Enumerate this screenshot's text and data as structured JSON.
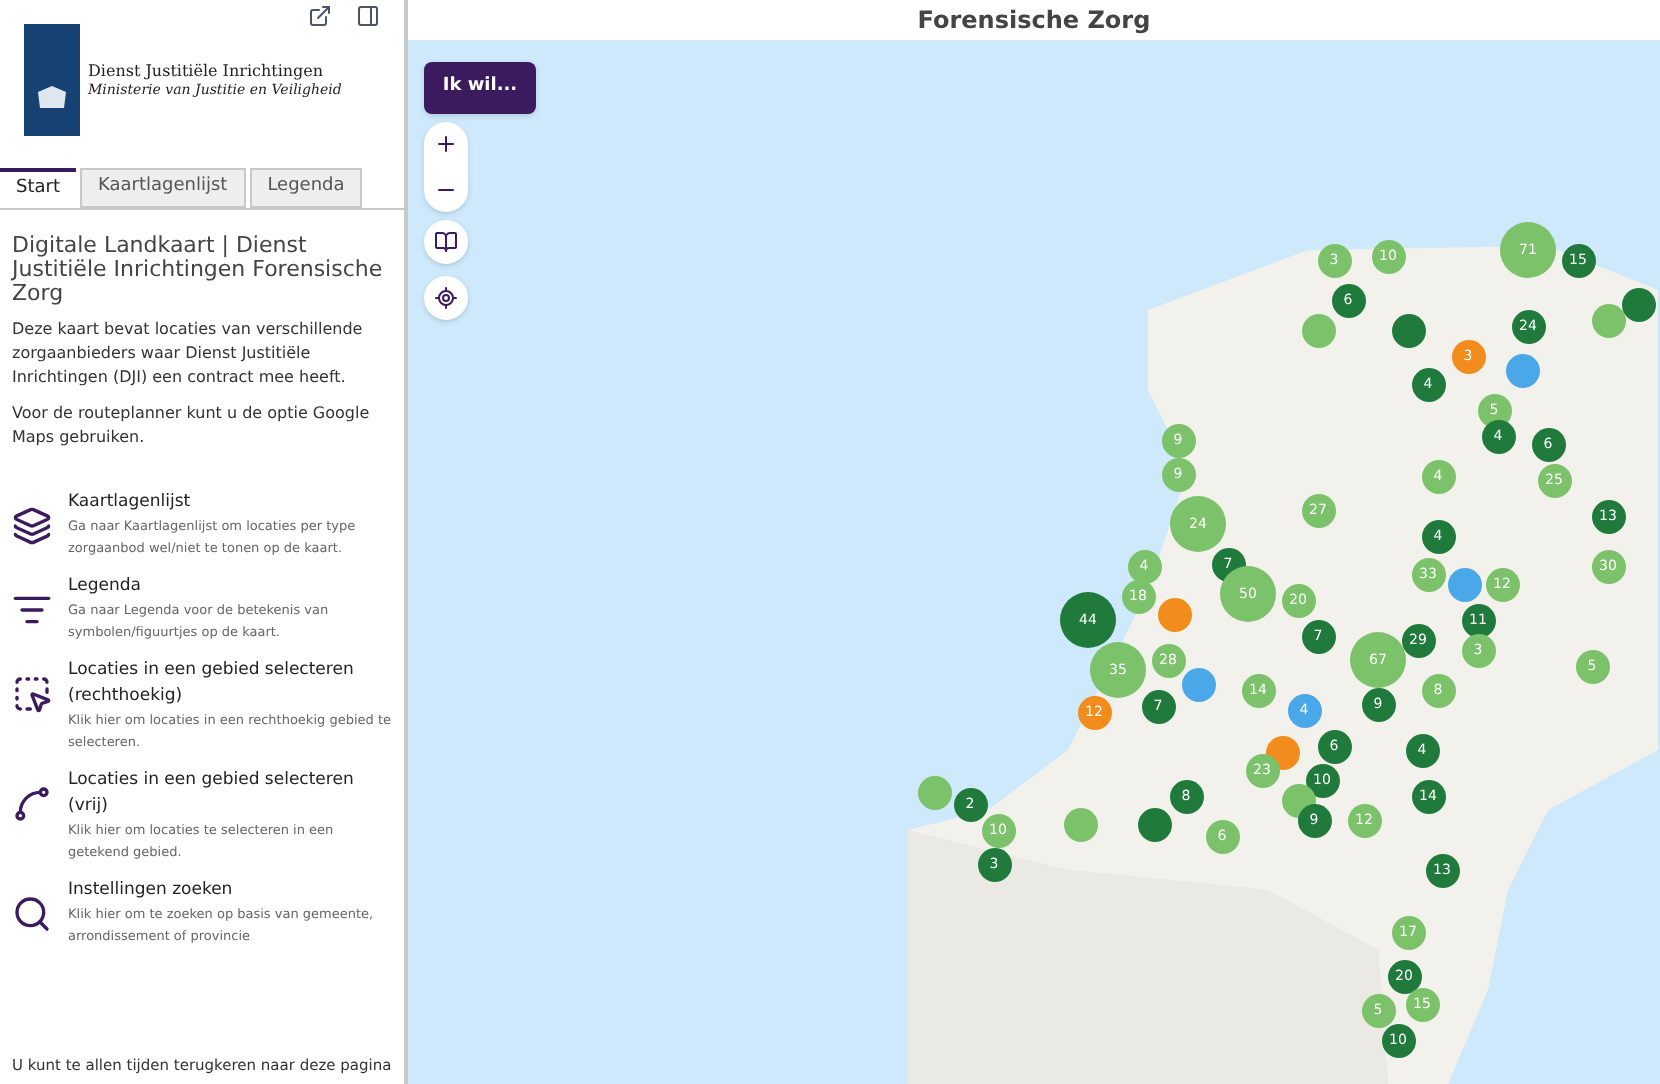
{
  "logo": {
    "line1": "Dienst Justitiële Inrichtingen",
    "line2": "Ministerie van Justitie en Veiligheid"
  },
  "tabs": [
    {
      "label": "Start",
      "selected": true
    },
    {
      "label": "Kaartlagenlijst",
      "selected": false
    },
    {
      "label": "Legenda",
      "selected": false
    }
  ],
  "intro": {
    "title": "Digitale Landkaart | Dienst Justitiële Inrichtingen Forensische Zorg",
    "paragraphs": [
      "Deze kaart bevat locaties van verschillende zorgaanbieders waar Dienst Justitiële Inrichtingen (DJI) een contract mee heeft.",
      "Voor de routeplanner kunt u de optie Google Maps gebruiken."
    ]
  },
  "tools": [
    {
      "kind": "layers",
      "title": "Kaartlagenlijst",
      "description": "Ga naar Kaartlagenlijst om locaties per type zorgaanbod wel/niet te tonen op de kaart."
    },
    {
      "kind": "legend",
      "title": "Legenda",
      "description": "Ga naar Legenda voor de betekenis van symbolen/figuurtjes op de kaart."
    },
    {
      "kind": "rectangle",
      "title": "Locaties in een gebied selecteren (rechthoekig)",
      "description": "Klik hier om locaties in een rechthoekig gebied te selecteren."
    },
    {
      "kind": "freehand",
      "title": "Locaties in een gebied selecteren (vrij)",
      "description": "Klik hier om locaties te selecteren in een getekend gebied."
    },
    {
      "kind": "search",
      "title": "Instellingen zoeken",
      "description": "Klik hier om te zoeken op basis van gemeente, arrondissement of provincie"
    }
  ],
  "footer": "U kunt te allen tijden terugkeren naar deze pagina",
  "map": {
    "title": "Forensische Zorg",
    "menu_button": "Ik wil...",
    "clusters": [
      {
        "count": "3",
        "color": "#7cc26a",
        "kind": "small"
      },
      {
        "count": "10",
        "color": "#7cc26a",
        "kind": "small"
      },
      {
        "count": "71",
        "color": "#7cc26a",
        "kind": "large"
      },
      {
        "count": "15",
        "color": "#1f7a3c",
        "kind": "small"
      },
      {
        "color": "#7cc26a",
        "kind": "small"
      },
      {
        "count": "6",
        "color": "#1f7a3c",
        "kind": "small"
      },
      {
        "color": "#1f7a3c",
        "kind": "small"
      },
      {
        "count": "3",
        "color": "#f28c1c",
        "kind": "small"
      },
      {
        "count": "24",
        "color": "#1f7a3c",
        "kind": "small"
      },
      {
        "color": "#7cc26a",
        "kind": "small"
      },
      {
        "color": "#1f7a3c",
        "kind": "small"
      },
      {
        "count": "4",
        "color": "#1f7a3c",
        "kind": "small"
      },
      {
        "color": "#4aa8e8",
        "kind": "small"
      },
      {
        "count": "5",
        "color": "#7cc26a",
        "kind": "small"
      },
      {
        "count": "9",
        "color": "#7cc26a",
        "kind": "small"
      },
      {
        "count": "9",
        "color": "#7cc26a",
        "kind": "small"
      },
      {
        "count": "4",
        "color": "#1f7a3c",
        "kind": "small"
      },
      {
        "count": "4",
        "color": "#7cc26a",
        "kind": "small"
      },
      {
        "count": "6",
        "color": "#1f7a3c",
        "kind": "small"
      },
      {
        "count": "4",
        "color": "#1f7a3c",
        "kind": "small"
      },
      {
        "count": "25",
        "color": "#7cc26a",
        "kind": "small"
      },
      {
        "count": "27",
        "color": "#7cc26a",
        "kind": "small"
      },
      {
        "count": "24",
        "color": "#7cc26a",
        "kind": "large"
      },
      {
        "count": "13",
        "color": "#1f7a3c",
        "kind": "small"
      },
      {
        "count": "4",
        "color": "#7cc26a",
        "kind": "small"
      },
      {
        "count": "7",
        "color": "#1f7a3c",
        "kind": "small"
      },
      {
        "count": "30",
        "color": "#7cc26a",
        "kind": "small"
      },
      {
        "count": "33",
        "color": "#7cc26a",
        "kind": "small"
      },
      {
        "color": "#4aa8e8",
        "kind": "small"
      },
      {
        "count": "12",
        "color": "#7cc26a",
        "kind": "small"
      },
      {
        "count": "44",
        "color": "#1f7a3c",
        "kind": "large"
      },
      {
        "count": "18",
        "color": "#7cc26a",
        "kind": "small"
      },
      {
        "count": "50",
        "color": "#7cc26a",
        "kind": "large"
      },
      {
        "count": "20",
        "color": "#7cc26a",
        "kind": "small"
      },
      {
        "color": "#f28c1c",
        "kind": "small"
      },
      {
        "count": "35",
        "color": "#7cc26a",
        "kind": "large"
      },
      {
        "count": "28",
        "color": "#7cc26a",
        "kind": "small"
      },
      {
        "count": "7",
        "color": "#1f7a3c",
        "kind": "small"
      },
      {
        "count": "67",
        "color": "#7cc26a",
        "kind": "large"
      },
      {
        "count": "29",
        "color": "#1f7a3c",
        "kind": "small"
      },
      {
        "count": "11",
        "color": "#1f7a3c",
        "kind": "small"
      },
      {
        "count": "3",
        "color": "#7cc26a",
        "kind": "small"
      },
      {
        "count": "12",
        "color": "#f28c1c",
        "kind": "small"
      },
      {
        "color": "#4aa8e8",
        "kind": "small"
      },
      {
        "count": "14",
        "color": "#7cc26a",
        "kind": "small"
      },
      {
        "count": "4",
        "color": "#4aa8e8",
        "kind": "small"
      },
      {
        "count": "9",
        "color": "#1f7a3c",
        "kind": "small"
      },
      {
        "count": "8",
        "color": "#7cc26a",
        "kind": "small"
      },
      {
        "count": "5",
        "color": "#7cc26a",
        "kind": "small"
      },
      {
        "count": "7",
        "color": "#1f7a3c",
        "kind": "small"
      },
      {
        "color": "#f28c1c",
        "kind": "small"
      },
      {
        "count": "23",
        "color": "#7cc26a",
        "kind": "small"
      },
      {
        "count": "6",
        "color": "#1f7a3c",
        "kind": "small"
      },
      {
        "count": "4",
        "color": "#1f7a3c",
        "kind": "small"
      },
      {
        "count": "10",
        "color": "#1f7a3c",
        "kind": "small"
      },
      {
        "count": "14",
        "color": "#1f7a3c",
        "kind": "small"
      },
      {
        "count": "8",
        "color": "#1f7a3c",
        "kind": "small"
      },
      {
        "count": "2",
        "color": "#1f7a3c",
        "kind": "small"
      },
      {
        "color": "#7cc26a",
        "kind": "small"
      },
      {
        "color": "#1f7a3c",
        "kind": "small"
      },
      {
        "color": "#7cc26a",
        "kind": "small"
      },
      {
        "count": "9",
        "color": "#1f7a3c",
        "kind": "small"
      },
      {
        "count": "12",
        "color": "#7cc26a",
        "kind": "small"
      },
      {
        "count": "6",
        "color": "#7cc26a",
        "kind": "small"
      },
      {
        "count": "10",
        "color": "#7cc26a",
        "kind": "small"
      },
      {
        "color": "#7cc26a",
        "kind": "small"
      },
      {
        "count": "3",
        "color": "#1f7a3c",
        "kind": "small"
      },
      {
        "count": "13",
        "color": "#1f7a3c",
        "kind": "small"
      },
      {
        "count": "17",
        "color": "#7cc26a",
        "kind": "small"
      },
      {
        "count": "20",
        "color": "#1f7a3c",
        "kind": "small"
      },
      {
        "count": "5",
        "color": "#7cc26a",
        "kind": "small"
      },
      {
        "count": "15",
        "color": "#7cc26a",
        "kind": "small"
      },
      {
        "count": "10",
        "color": "#1f7a3c",
        "kind": "small"
      }
    ]
  }
}
